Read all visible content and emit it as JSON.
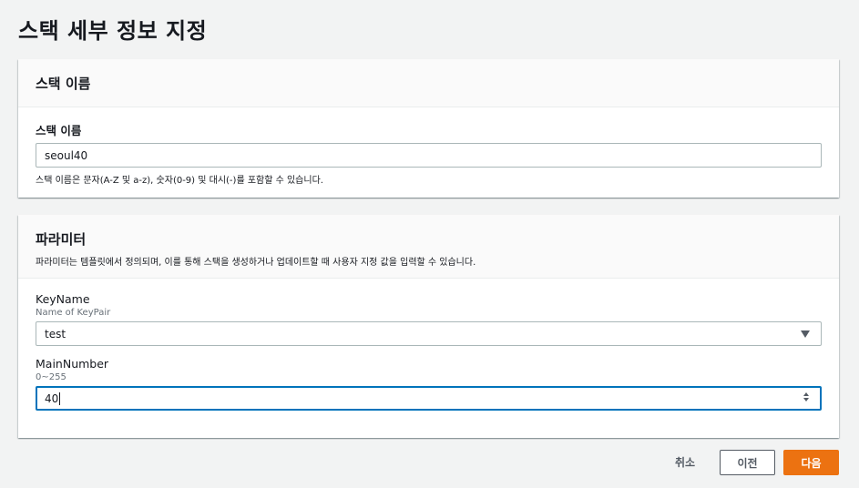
{
  "page": {
    "title": "스택 세부 정보 지정"
  },
  "stack_name_panel": {
    "header": "스택 이름",
    "field_label": "스택 이름",
    "value": "seoul40",
    "hint": "스택 이름은 문자(A-Z 및 a-z), 숫자(0-9) 및 대시(-)를 포함할 수 있습니다."
  },
  "parameters_panel": {
    "header": "파라미터",
    "description": "파라미터는 템플릿에서 정의되며, 이를 통해 스택을 생성하거나 업데이트할 때 사용자 지정 값을 입력할 수 있습니다.",
    "key_name": {
      "label": "KeyName",
      "description": "Name of KeyPair",
      "selected": "test"
    },
    "main_number": {
      "label": "MainNumber",
      "description": "0~255",
      "value": "40"
    }
  },
  "footer": {
    "cancel_label": "취소",
    "previous_label": "이전",
    "next_label": "다음"
  },
  "colors": {
    "primary": "#ec7211",
    "focus": "#0073bb",
    "background": "#f2f3f3"
  },
  "icons": {
    "select_caret": "caret-down-icon",
    "spinner": "spinner-icon"
  }
}
